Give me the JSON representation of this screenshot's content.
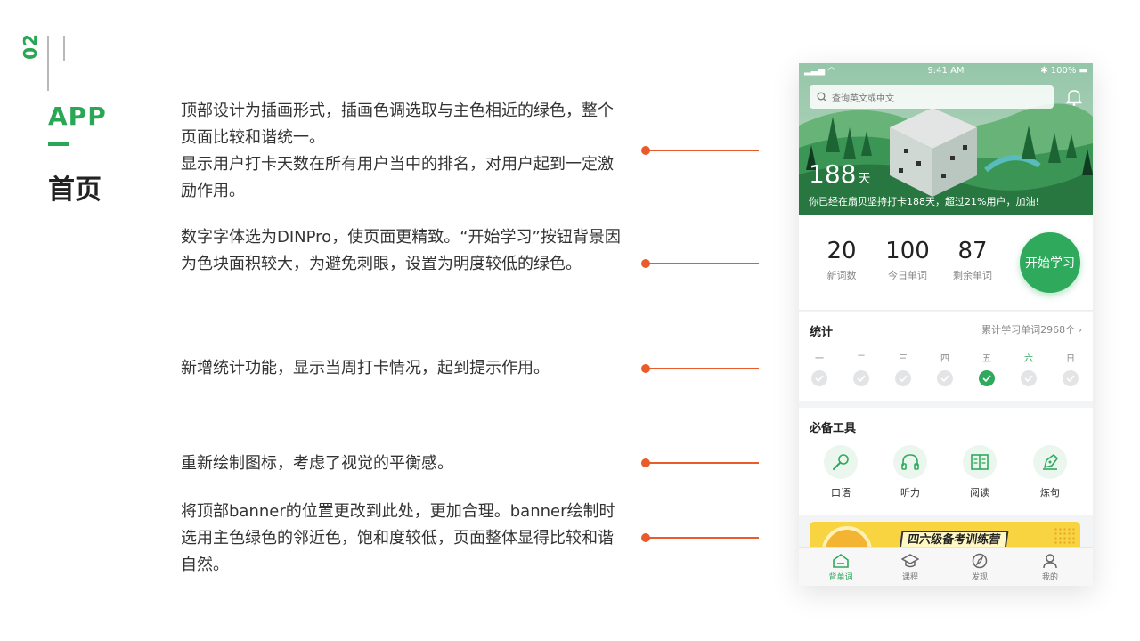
{
  "slide": {
    "number": "02",
    "section": "APP",
    "title": "首页"
  },
  "notes": [
    {
      "text": "顶部设计为插画形式，插画色调选取与主色相近的绿色，整个页面比较和谐统一。\n显示用户打卡天数在所有用户当中的排名，对用户起到一定激励作用。"
    },
    {
      "text": "数字字体选为DINPro，使页面更精致。“开始学习”按钮背景因为色块面积较大，为避免刺眼，设置为明度较低的绿色。"
    },
    {
      "text": "新增统计功能，显示当周打卡情况，起到提示作用。"
    },
    {
      "text": "重新绘制图标，考虑了视觉的平衡感。"
    },
    {
      "text": "将顶部banner的位置更改到此处，更加合理。banner绘制时选用主色绿色的邻近色，饱和度较低，页面整体显得比较和谐自然。"
    }
  ],
  "colors": {
    "accent": "#2aa655",
    "connector": "#ea5b2c",
    "button": "#2faa5d"
  },
  "phone": {
    "status": {
      "time": "9:41 AM",
      "battery": "100%"
    },
    "search_placeholder": "查询英文或中文",
    "days_value": "188",
    "days_unit": "天",
    "checkin_text": "你已经在扇贝坚持打卡188天，超过21%用户，加油!",
    "stats": [
      {
        "value": "20",
        "label": "新词数"
      },
      {
        "value": "100",
        "label": "今日单词"
      },
      {
        "value": "87",
        "label": "剩余单词"
      }
    ],
    "start_button": "开始学习",
    "week": {
      "title": "统计",
      "total": "累计学习单词2968个",
      "days": [
        {
          "label": "一",
          "checked": false,
          "highlight": false
        },
        {
          "label": "二",
          "checked": false,
          "highlight": false
        },
        {
          "label": "三",
          "checked": false,
          "highlight": false
        },
        {
          "label": "四",
          "checked": false,
          "highlight": false
        },
        {
          "label": "五",
          "checked": true,
          "highlight": false
        },
        {
          "label": "六",
          "checked": false,
          "highlight": true
        },
        {
          "label": "日",
          "checked": false,
          "highlight": false
        }
      ]
    },
    "tools": {
      "title": "必备工具",
      "items": [
        {
          "label": "口语",
          "icon": "microphone-icon"
        },
        {
          "label": "听力",
          "icon": "headphones-icon"
        },
        {
          "label": "阅读",
          "icon": "book-icon"
        },
        {
          "label": "炼句",
          "icon": "pen-icon"
        }
      ]
    },
    "promo_text": "四六级备考训练营",
    "tabs": [
      {
        "label": "背单词",
        "icon": "home-icon",
        "active": true
      },
      {
        "label": "课程",
        "icon": "graduation-cap-icon",
        "active": false
      },
      {
        "label": "发现",
        "icon": "compass-icon",
        "active": false
      },
      {
        "label": "我的",
        "icon": "user-icon",
        "active": false
      }
    ]
  }
}
